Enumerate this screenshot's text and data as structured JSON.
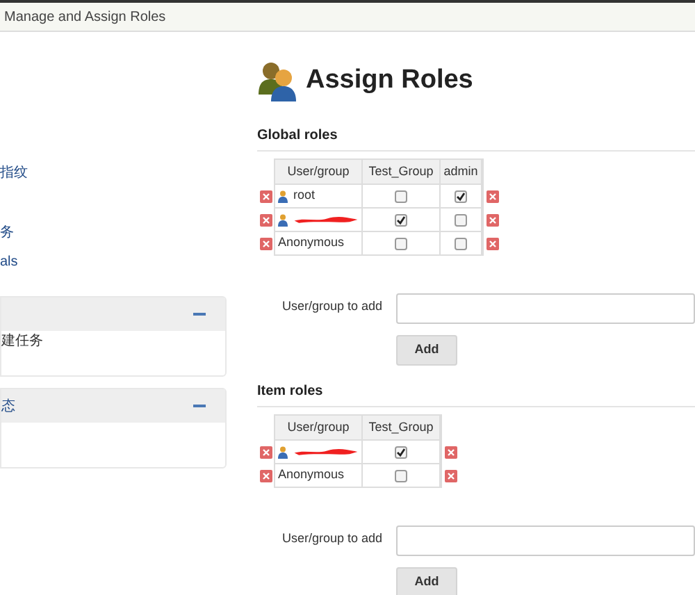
{
  "breadcrumb": "Manage and Assign Roles",
  "sidebar": {
    "items": [
      "指纹",
      "务",
      "als"
    ],
    "panels": [
      {
        "rows": [
          "建任务"
        ]
      },
      {
        "header": "态"
      }
    ]
  },
  "title": "Assign Roles",
  "sections": [
    {
      "heading": "Global roles",
      "columns": [
        "User/group",
        "Test_Group",
        "admin"
      ],
      "rows": [
        {
          "kind": "user",
          "name": "root",
          "checks": [
            false,
            true
          ]
        },
        {
          "kind": "redacted",
          "checks": [
            true,
            false
          ]
        },
        {
          "kind": "plain",
          "name": "Anonymous",
          "checks": [
            false,
            false
          ]
        }
      ],
      "add_label": "User/group to add",
      "add_button": "Add"
    },
    {
      "heading": "Item roles",
      "columns": [
        "User/group",
        "Test_Group"
      ],
      "rows": [
        {
          "kind": "redacted",
          "checks": [
            true
          ]
        },
        {
          "kind": "plain",
          "name": "Anonymous",
          "checks": [
            false
          ]
        }
      ],
      "add_label": "User/group to add",
      "add_button": "Add"
    }
  ]
}
